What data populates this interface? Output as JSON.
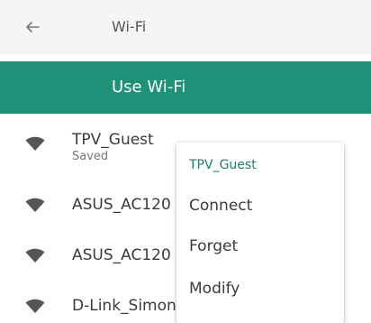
{
  "header": {
    "back_icon": "arrow-left-icon",
    "title": "Wi-Fi"
  },
  "toggle": {
    "label": "Use Wi-Fi",
    "color": "#1e9178"
  },
  "networks": [
    {
      "name": "TPV_Guest",
      "status": "Saved",
      "icon": "wifi-signal-icon"
    },
    {
      "name": "ASUS_AC120",
      "icon": "wifi-signal-icon"
    },
    {
      "name": "ASUS_AC120",
      "icon": "wifi-signal-icon"
    },
    {
      "name": "D-Link_Simon",
      "icon": "wifi-signal-icon"
    }
  ],
  "context_menu": {
    "title": "TPV_Guest",
    "items": [
      "Connect",
      "Forget",
      "Modify"
    ],
    "accent_color": "#1e7f6b"
  }
}
